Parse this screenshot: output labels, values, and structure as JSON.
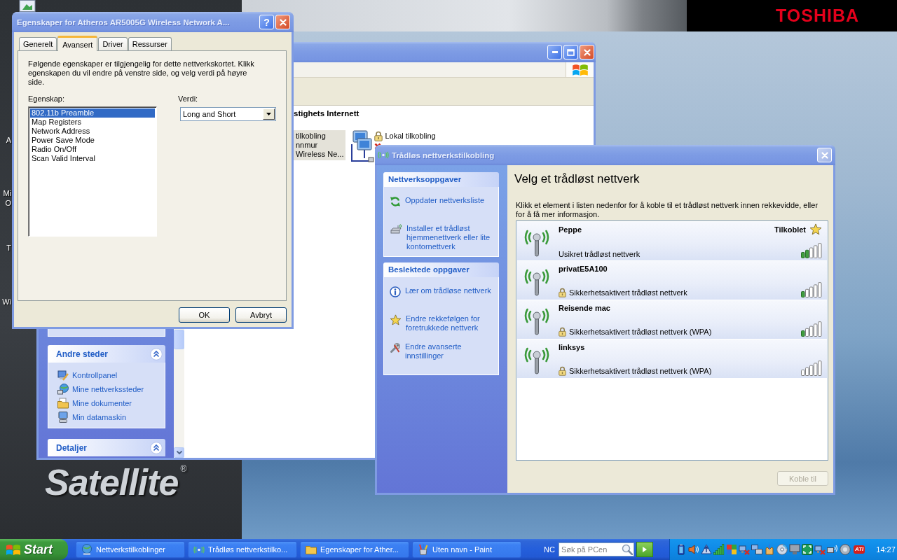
{
  "desktop": {
    "icon_labels": [
      {
        "lines": [
          "A"
        ]
      },
      {
        "lines": [
          "Mi",
          "O"
        ]
      },
      {
        "lines": [
          "T"
        ]
      },
      {
        "lines": [
          "Wi"
        ]
      }
    ],
    "brand": "TOSHIBA",
    "logo": "Satellite$^{®}$"
  },
  "connections_window": {
    "task_pane": {
      "groups": [
        {
          "title": "Andre steder",
          "expanded": true,
          "links": [
            {
              "kind": "control_panel",
              "label": "Kontrollpanel"
            },
            {
              "kind": "network",
              "label": "Mine nettverkssteder"
            },
            {
              "kind": "documents",
              "label": "Mine dokumenter"
            },
            {
              "kind": "computer",
              "label": "Min datamaskin"
            }
          ]
        },
        {
          "title": "Detaljer",
          "expanded": true
        }
      ]
    },
    "section_heading": "stighets Internett",
    "connections": [
      {
        "kind": "text",
        "lines": [
          "tilkobling",
          "nnmur",
          "Wireless Ne..."
        ],
        "selected": true
      },
      {
        "kind": "lan",
        "lines": [
          "Lokal tilkobling"
        ],
        "selected": false,
        "firewall": true,
        "disconnected": true
      }
    ]
  },
  "properties_dialog": {
    "title": "Egenskaper for Atheros AR5005G Wireless Network A...",
    "help_button": "?",
    "tabs": [
      {
        "label": "Generelt",
        "selected": false
      },
      {
        "label": "Avansert",
        "selected": true
      },
      {
        "label": "Driver",
        "selected": false
      },
      {
        "label": "Ressurser",
        "selected": false
      }
    ],
    "description": "Følgende egenskaper er tilgjengelig for dette nettverkskortet. Klikk egenskapen du vil endre på venstre side, og velg verdi på høyre side.",
    "property_label": "Egenskap:",
    "properties": [
      {
        "label": "802.11b Preamble",
        "selected": true
      },
      {
        "label": "Map Registers",
        "selected": false
      },
      {
        "label": "Network Address",
        "selected": false
      },
      {
        "label": "Power Save Mode",
        "selected": false
      },
      {
        "label": "Radio On/Off",
        "selected": false
      },
      {
        "label": "Scan Valid Interval",
        "selected": false
      }
    ],
    "value_label": "Verdi:",
    "value": "Long and Short",
    "buttons": [
      "OK",
      "Avbryt"
    ]
  },
  "wireless_window": {
    "title": "Trådløs nettverkstilkobling",
    "task_groups": [
      {
        "title": "Nettverksoppgaver",
        "links": [
          {
            "kind": "refresh",
            "label": "Oppdater nettverksliste"
          },
          {
            "kind": "wizard",
            "label": "Installer et trådløst hjemmenettverk eller lite kontornettverk"
          }
        ]
      },
      {
        "title": "Beslektede oppgaver",
        "links": [
          {
            "kind": "info",
            "label": "Lær om trådløse nettverk"
          },
          {
            "kind": "star",
            "label": "Endre rekkefølgen for foretrukkede nettverk"
          },
          {
            "kind": "tools",
            "label": "Endre avanserte innstillinger"
          }
        ]
      }
    ],
    "heading": "Velg et trådløst nettverk",
    "instructions": "Klikk et element i listen nedenfor for å koble til et trådløst nettverk innen rekkevidde, eller for å få mer informasjon.",
    "networks": [
      {
        "kind": "low",
        "name": "Peppe",
        "status": "Tilkoblet",
        "connected": true,
        "secured": false,
        "description": "Usikret trådløst nettverk"
      },
      {
        "kind": "very_low",
        "name": "privatE5A100",
        "connected": false,
        "secured": true,
        "description": "Sikkerhetsaktivert trådløst nettverk"
      },
      {
        "kind": "very_low",
        "name": "Reisende mac",
        "connected": false,
        "secured": true,
        "description": "Sikkerhetsaktivert trådløst nettverk (WPA)"
      },
      {
        "kind": "none",
        "name": "linksys",
        "connected": false,
        "secured": true,
        "description": "Sikkerhetsaktivert trådløst nettverk (WPA)"
      }
    ],
    "connect_button": {
      "label": "Koble til",
      "disabled": true
    }
  },
  "taskbar": {
    "start_label": "Start",
    "buttons": [
      {
        "kind": "network",
        "label": "Nettverkstilkoblinger",
        "selected": false
      },
      {
        "kind": "wireless",
        "label": "Trådløs nettverkstilko...",
        "selected": false
      },
      {
        "kind": "folder",
        "label": "Egenskaper for Ather...",
        "selected": false
      },
      {
        "kind": "paint",
        "label": "Uten navn - Paint",
        "selected": false
      }
    ],
    "search": {
      "prefix": "NC",
      "placeholder": "Søk på PCen"
    },
    "tray": {
      "logo_text": "ATI",
      "clock": "14:27"
    }
  }
}
